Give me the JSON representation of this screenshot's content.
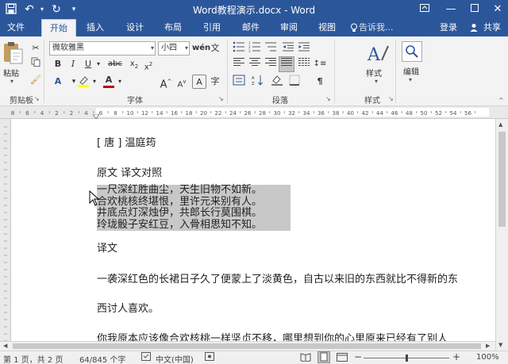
{
  "window": {
    "title": "Word教程演示.docx - Word"
  },
  "tabs": [
    "文件",
    "开始",
    "插入",
    "设计",
    "布局",
    "引用",
    "邮件",
    "审阅",
    "视图"
  ],
  "tell_me": "告诉我...",
  "signin": "登录",
  "share": "共享",
  "ribbon": {
    "clipboard": {
      "paste": "粘贴",
      "label": "剪贴板"
    },
    "font": {
      "name": "微软雅黑",
      "size": "小四",
      "bold": "B",
      "italic": "I",
      "underline": "U",
      "strike": "abc",
      "label": "字体"
    },
    "paragraph": {
      "label": "段落"
    },
    "styles": {
      "label_btn": "样式",
      "label": "样式"
    },
    "editing": {
      "label": "编辑"
    }
  },
  "ruler": {
    "numbers": [
      "8",
      "6",
      "4",
      "2",
      "2",
      "4",
      "6",
      "8",
      "10",
      "12",
      "14",
      "16",
      "18",
      "20",
      "22",
      "24",
      "26",
      "28",
      "30",
      "32",
      "34",
      "36",
      "38",
      "40",
      "42",
      "44",
      "46",
      "48",
      "50",
      "52",
      "54",
      "56"
    ]
  },
  "doc": {
    "author": "[ 唐 ] 温庭筠",
    "section": "原文  译文对照",
    "poem": [
      "一尺深红胜曲尘，天生旧物不如新。",
      "合欢桃核终堪恨，里许元来别有人。",
      "井底点灯深烛伊，共郎长行莫围棋。",
      "玲珑骰子安红豆，入骨相思知不知。"
    ],
    "translation_heading": "译文",
    "translation": [
      "一袭深红色的长裙日子久了便蒙上了淡黄色，自古以来旧的东西就比不得新的东",
      "西讨人喜欢。",
      "你我原本应该像合欢核桃一样坚贞不移，哪里想到你的心里原来已经有了别人"
    ]
  },
  "status": {
    "page": "第 1 页，共 2 页",
    "words": "64/845 个字",
    "language": "中文(中国)",
    "zoom": "100%"
  },
  "colors": {
    "title_bar": "#2b579a",
    "ribbon_bg": "#f3f3f3",
    "selection": "#c8c8c8"
  }
}
